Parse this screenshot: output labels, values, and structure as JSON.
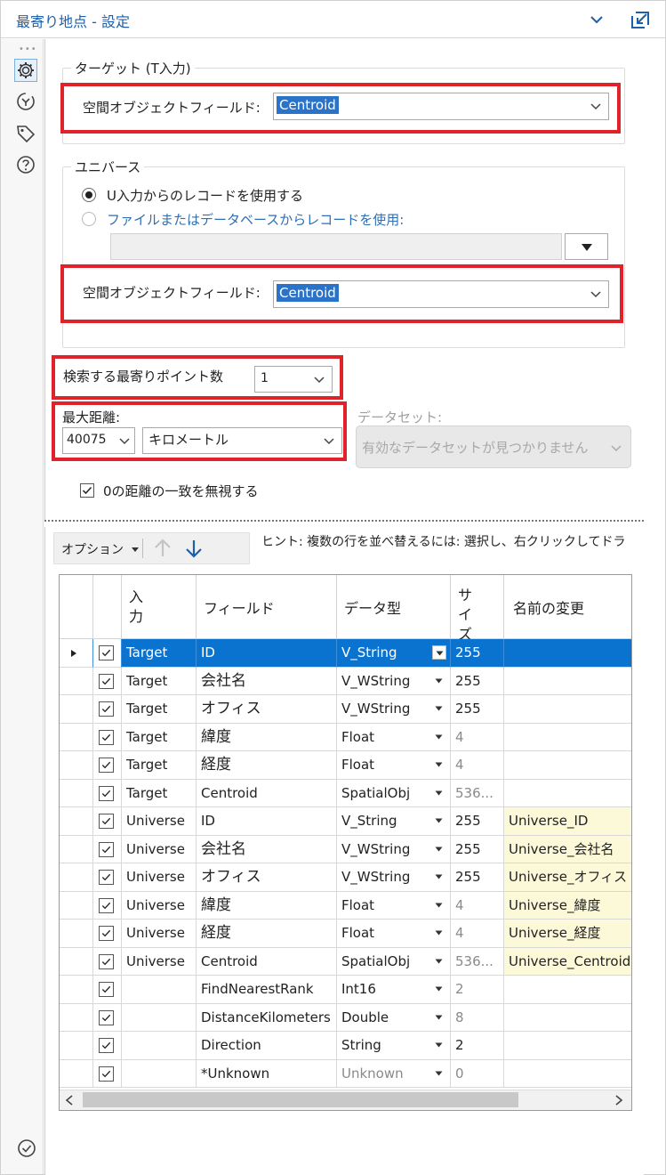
{
  "window": {
    "title": "最寄り地点 - 設定"
  },
  "target_group": {
    "title": "ターゲット (T入力)",
    "spatial_label": "空間オブジェクトフィールド:",
    "spatial_value": "Centroid"
  },
  "universe_group": {
    "title": "ユニバース",
    "radio_u_input": "U入力からのレコードを使用する",
    "radio_file_db": "ファイルまたはデータベースからレコードを使用:",
    "spatial_label": "空間オブジェクトフィールド:",
    "spatial_value": "Centroid"
  },
  "search": {
    "nearest_label": "検索する最寄りポイント数",
    "nearest_value": "1",
    "maxdist_label": "最大距離:",
    "maxdist_value": "40075",
    "unit_value": "キロメートル",
    "dataset_label": "データセット:",
    "dataset_value": "有効なデータセットが見つかりません",
    "ignore_zero_label": "0の距離の一致を無視する"
  },
  "toolbar": {
    "options_label": "オプション",
    "hint": "ヒント: 複数の行を並べ替えるには: 選択し、右クリックしてドラ"
  },
  "grid": {
    "headers": {
      "input": "入力",
      "field": "フィールド",
      "type": "データ型",
      "size": "サイズ",
      "rename": "名前の変更"
    },
    "rows": [
      {
        "input": "Target",
        "field": "ID",
        "type": "V_String",
        "size": "255",
        "rename": ""
      },
      {
        "input": "Target",
        "field": "会社名",
        "type": "V_WString",
        "size": "255",
        "rename": ""
      },
      {
        "input": "Target",
        "field": "オフィス",
        "type": "V_WString",
        "size": "255",
        "rename": ""
      },
      {
        "input": "Target",
        "field": "緯度",
        "type": "Float",
        "size": "4",
        "rename": ""
      },
      {
        "input": "Target",
        "field": "経度",
        "type": "Float",
        "size": "4",
        "rename": ""
      },
      {
        "input": "Target",
        "field": "Centroid",
        "type": "SpatialObj",
        "size": "536...",
        "rename": ""
      },
      {
        "input": "Universe",
        "field": "ID",
        "type": "V_String",
        "size": "255",
        "rename": "Universe_ID"
      },
      {
        "input": "Universe",
        "field": "会社名",
        "type": "V_WString",
        "size": "255",
        "rename": "Universe_会社名"
      },
      {
        "input": "Universe",
        "field": "オフィス",
        "type": "V_WString",
        "size": "255",
        "rename": "Universe_オフィス"
      },
      {
        "input": "Universe",
        "field": "緯度",
        "type": "Float",
        "size": "4",
        "rename": "Universe_緯度"
      },
      {
        "input": "Universe",
        "field": "経度",
        "type": "Float",
        "size": "4",
        "rename": "Universe_経度"
      },
      {
        "input": "Universe",
        "field": "Centroid",
        "type": "SpatialObj",
        "size": "536...",
        "rename": "Universe_Centroid"
      },
      {
        "input": "",
        "field": "FindNearestRank",
        "type": "Int16",
        "size": "2",
        "rename": ""
      },
      {
        "input": "",
        "field": "DistanceKilometers",
        "type": "Double",
        "size": "8",
        "rename": ""
      },
      {
        "input": "",
        "field": "Direction",
        "type": "String",
        "size": "2",
        "rename": ""
      },
      {
        "input": "",
        "field": "*Unknown",
        "type": "Unknown",
        "size": "0",
        "rename": ""
      }
    ]
  }
}
